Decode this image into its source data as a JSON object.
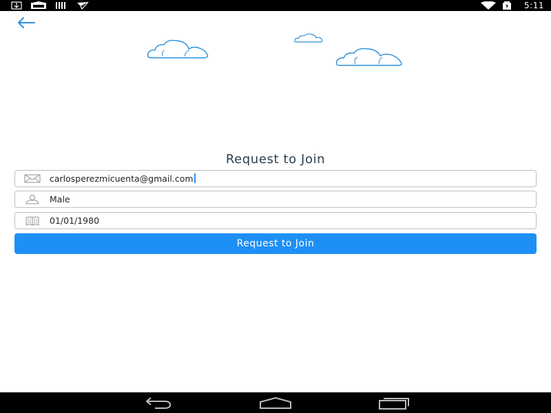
{
  "status_bar": {
    "time": "5:11",
    "left_icons": [
      "download-icon",
      "image-icon",
      "barcode-icon",
      "send-icon"
    ],
    "right_icons": [
      "wifi-icon",
      "battery-icon"
    ]
  },
  "header": {
    "back_icon": "arrow-left-icon"
  },
  "decor": {
    "clouds": [
      "cloud-icon",
      "cloud-icon",
      "cloud-icon"
    ]
  },
  "form": {
    "title": "Request to Join",
    "email": {
      "icon": "envelope-icon",
      "value": "carlosperezmicuenta@gmail.com"
    },
    "gender": {
      "icon": "person-icon",
      "value": "Male"
    },
    "birthdate": {
      "icon": "calendar-icon",
      "value": "01/01/1980"
    },
    "submit_label": "Request to Join"
  },
  "nav_bar": {
    "icons": [
      "back-nav-icon",
      "home-nav-icon",
      "recents-nav-icon"
    ]
  },
  "colors": {
    "accent": "#1e90f5",
    "title_text": "#2c3e50",
    "cloud_stroke": "#2a8fd8",
    "field_border": "#bfbfbf"
  }
}
